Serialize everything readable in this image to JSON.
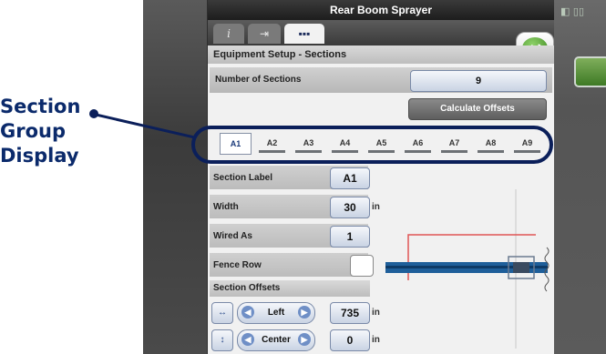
{
  "callout": {
    "lines": [
      "Section",
      "Group",
      "Display"
    ]
  },
  "window": {
    "title": "Rear Boom Sprayer"
  },
  "tabs": [
    {
      "label": "i",
      "icon": "info-icon"
    },
    {
      "label": "⇥",
      "icon": "tools-icon"
    },
    {
      "label": "▪▪▪",
      "icon": "sections-icon"
    }
  ],
  "header": {
    "title": "Equipment Setup - Sections"
  },
  "number_of_sections": {
    "label": "Number of Sections",
    "value": "9"
  },
  "calculate_offsets": {
    "label": "Calculate Offsets"
  },
  "sections": [
    "A1",
    "A2",
    "A3",
    "A4",
    "A5",
    "A6",
    "A7",
    "A8",
    "A9"
  ],
  "selected_section": "A1",
  "form": {
    "section_label": {
      "label": "Section Label",
      "value": "A1"
    },
    "width": {
      "label": "Width",
      "value": "30",
      "unit": "in"
    },
    "wired_as": {
      "label": "Wired As",
      "value": "1"
    },
    "fence_row": {
      "label": "Fence Row"
    }
  },
  "offsets": {
    "title": "Section Offsets",
    "horizontal": {
      "direction": "Left",
      "value": "735",
      "unit": "in"
    },
    "vertical": {
      "direction": "Center",
      "value": "0",
      "unit": "in"
    }
  },
  "colors": {
    "callout": "#0b1f5a",
    "accent": "#7a8aa8",
    "boom": "#1f5f9a",
    "guide": "#e05555"
  }
}
